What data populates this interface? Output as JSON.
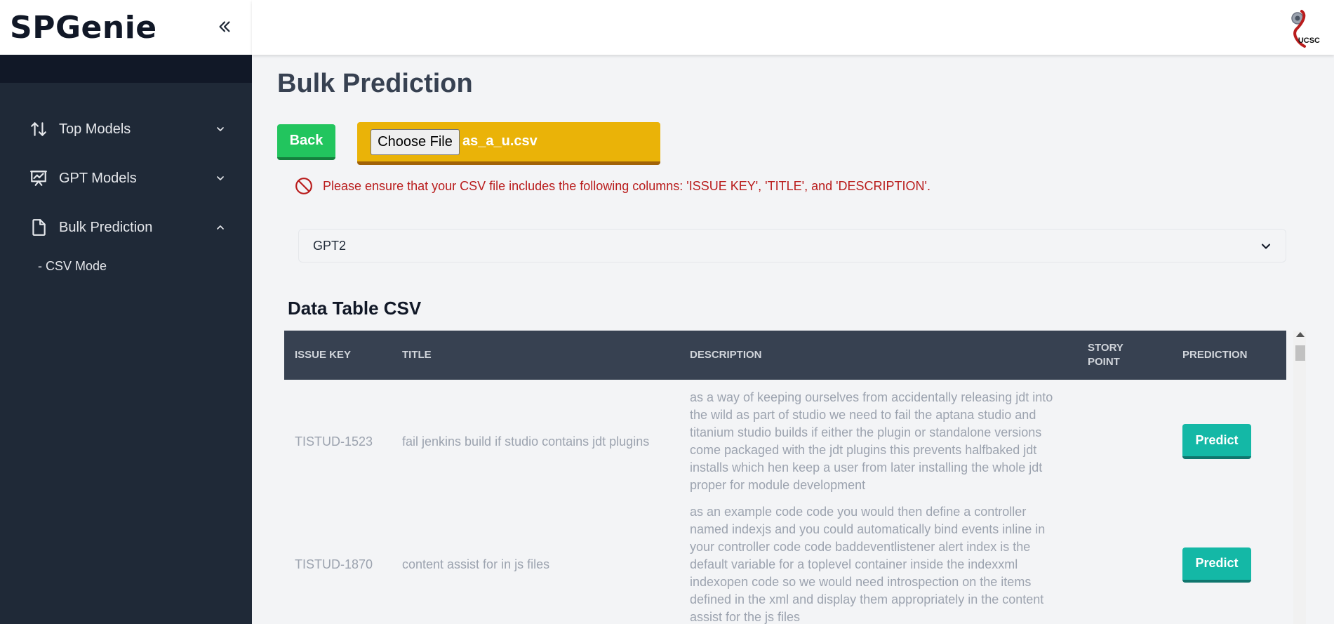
{
  "app": {
    "brand": "SPGenie"
  },
  "sidebar": {
    "items": [
      {
        "label": "Top Models",
        "icon": "sort-arrows-icon"
      },
      {
        "label": "GPT Models",
        "icon": "presentation-chart-icon"
      },
      {
        "label": "Bulk Prediction",
        "icon": "document-icon"
      }
    ],
    "sub_items": [
      {
        "label": "- CSV Mode"
      }
    ]
  },
  "header": {
    "logo_text": "UCSC"
  },
  "main": {
    "title": "Bulk Prediction",
    "back_label": "Back",
    "choose_file_label": "Choose File",
    "file_name": "as_a_u.csv",
    "warning": "Please ensure that your CSV file includes the following columns: 'ISSUE KEY', 'TITLE', and 'DESCRIPTION'.",
    "model_select": {
      "selected": "GPT2"
    },
    "table_title": "Data Table CSV"
  },
  "table": {
    "headers": {
      "issue_key": "ISSUE KEY",
      "title": "TITLE",
      "description": "DESCRIPTION",
      "story_point_1": "STORY",
      "story_point_2": "POINT",
      "prediction": "PREDICTION"
    },
    "rows": [
      {
        "issue_key": "TISTUD-1523",
        "title": "fail jenkins build if studio contains jdt plugins",
        "description": "as a way of keeping ourselves from accidentally releasing jdt into the wild as part of studio we need to fail the aptana studio and titanium studio builds if either the plugin or standalone versions come packaged with the jdt plugins this prevents halfbaked jdt installs which hen keep a user from later installing the whole jdt proper for module development",
        "story_point": "",
        "action": "Predict"
      },
      {
        "issue_key": "TISTUD-1870",
        "title": "content assist for in js files",
        "description": "as an example code code you would then define a controller named indexjs and you could automatically bind events inline in your controller code code baddeventlistener alert index is the default variable for a toplevel container inside the indexxml indexopen code so we would need introspection on the items defined in the xml and display them appropriately in the content assist for the js files",
        "story_point": "",
        "action": "Predict"
      }
    ]
  },
  "colors": {
    "sidebar": "#1f2937",
    "back_button": "#22c55e",
    "file_box": "#eab308",
    "predict_button": "#14b8a6",
    "warning_text": "#b91c1c",
    "table_header": "#374151"
  }
}
